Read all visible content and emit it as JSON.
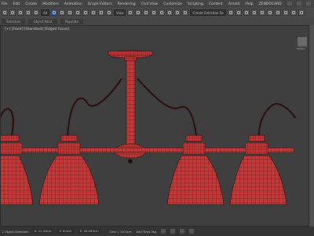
{
  "menubar": {
    "items": [
      "File",
      "Edit",
      "Create",
      "Modifiers",
      "Animation",
      "Graph Editors",
      "Rendering",
      "Civil View",
      "Customize",
      "Scripting",
      "Content",
      "Arnold",
      "Help",
      "ZENDOCARD"
    ]
  },
  "toolbar": {
    "selection_filter": "All",
    "view_dropdown": "View",
    "named_selection": "Create Selection Se"
  },
  "ribbon": {
    "items": [
      "Selection",
      "Object Paint",
      "Populate"
    ]
  },
  "viewport": {
    "label": "[+] [Front] [Standard] [Edged Faces]",
    "viewcube_label": "FRONT"
  },
  "status": {
    "selected": "1 Object Selected",
    "x": "X: 11.39cm",
    "y": "Y: 0.0cm",
    "z": "Z: 45.083cm",
    "grid": "Grid = 10.0cm",
    "add_time_tag": "Add Time Tag"
  },
  "colors": {
    "background": "#3f3f3f",
    "mesh": "#c43a3a",
    "wire": "#2a0a0a",
    "accent": "#2e6bbf"
  }
}
